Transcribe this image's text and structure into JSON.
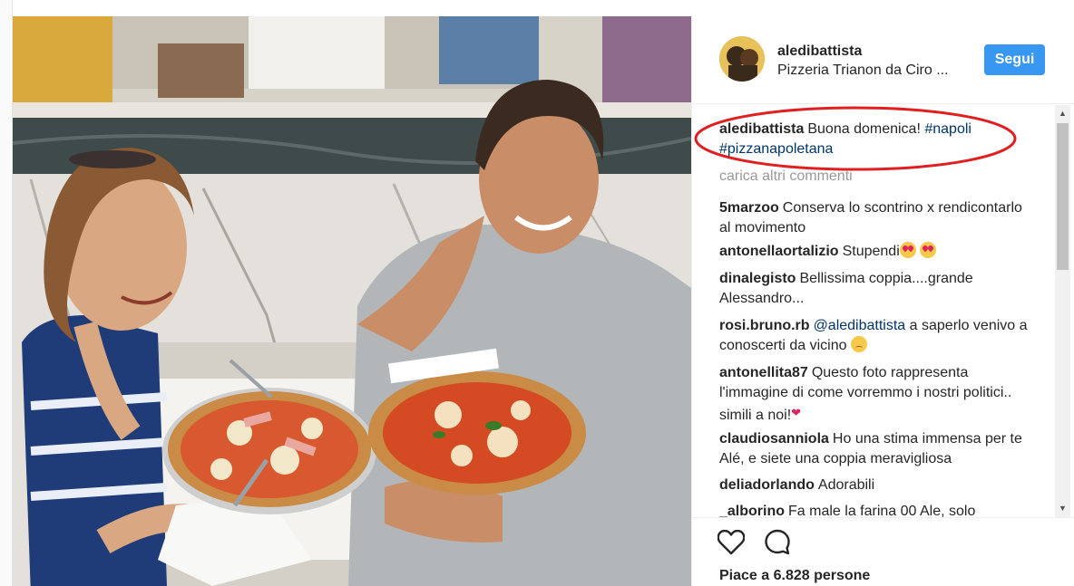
{
  "post": {
    "username": "aledibattista",
    "location": "Pizzeria Trianon da Ciro ...",
    "follow_label": "Segui"
  },
  "caption": {
    "username": "aledibattista",
    "text": "Buona domenica! ",
    "hashtags": [
      "#napoli",
      "#pizzanapoletana"
    ]
  },
  "load_more_label": "carica altri commenti",
  "comments": [
    {
      "username": "5marzoo",
      "text": "Conserva lo scontrino x rendicontarlo al movimento"
    },
    {
      "username": "antonellaortalizio",
      "text": "Stupendi",
      "emoji": "heart-eyes-face x2"
    },
    {
      "username": "dinalegisto",
      "text": "Bellissima coppia....grande Alessandro..."
    },
    {
      "username": "rosi.bruno.rb",
      "mention": "@aledibattista",
      "text": " a saperlo venivo a conoscerti da vicino",
      "emoji": "pensive-face"
    },
    {
      "username": "antonellita87",
      "text": "Questo foto rappresenta l'immagine di come vorremmo i nostri politici.. simili a noi!",
      "emoji": "red-heart"
    },
    {
      "username": "claudiosanniola",
      "text": "Ho una stima immensa per te Alé, e siete una coppia meravigliosa"
    },
    {
      "username": "deliadorlando",
      "text": "Adorabili"
    },
    {
      "username": "_alborino",
      "text": "Fa male la farina 00 Ale, solo"
    }
  ],
  "likes_text": "Piace a 6.828 persone",
  "icons": {
    "like": "heart-outline-icon",
    "comment": "speech-bubble-icon",
    "scroll_up": "scroll-up-arrow-icon",
    "scroll_down": "scroll-down-arrow-icon"
  },
  "colors": {
    "follow_button": "#3897f0",
    "hashtag": "#003569",
    "load_more": "#999999",
    "annotation_circle": "#e02020"
  }
}
